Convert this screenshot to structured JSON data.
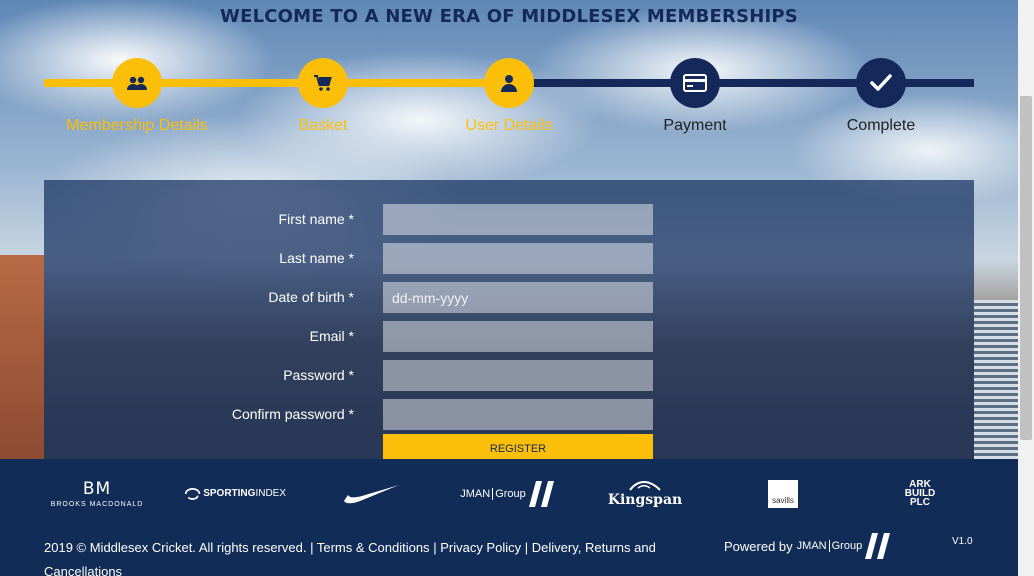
{
  "page": {
    "title": "WELCOME TO A NEW ERA OF MIDDLESEX MEMBERSHIPS"
  },
  "colors": {
    "navy": "#14295a",
    "accent": "#fbbf09",
    "footer": "#112c56"
  },
  "steps": [
    {
      "label": "Membership Details",
      "icon": "users-icon",
      "state": "done"
    },
    {
      "label": "Basket",
      "icon": "cart-icon",
      "state": "done"
    },
    {
      "label": "User Details",
      "icon": "user-icon",
      "state": "done"
    },
    {
      "label": "Payment",
      "icon": "credit-card-icon",
      "state": "todo"
    },
    {
      "label": "Complete",
      "icon": "checkmark-icon",
      "state": "todo"
    }
  ],
  "form": {
    "first_name": {
      "label": "First name *",
      "value": "",
      "placeholder": ""
    },
    "last_name": {
      "label": "Last name *",
      "value": "",
      "placeholder": ""
    },
    "dob": {
      "label": "Date of birth *",
      "value": "",
      "placeholder": "dd-mm-yyyy"
    },
    "email": {
      "label": "Email *",
      "value": "",
      "placeholder": ""
    },
    "password": {
      "label": "Password *",
      "value": "",
      "placeholder": ""
    },
    "confirm_password": {
      "label": "Confirm password *",
      "value": "",
      "placeholder": ""
    },
    "register_label": "REGISTER"
  },
  "sponsors": {
    "brooks_macdonald": {
      "mark": "BM",
      "name": "BROOKS MACDONALD"
    },
    "sporting_index": {
      "a": "SPORTING",
      "b": "INDEX"
    },
    "nike": {
      "icon": "nike-swoosh-icon"
    },
    "jman": {
      "a": "JMAN",
      "b": "Group"
    },
    "kingspan": {
      "name": "Kingspan"
    },
    "savills": {
      "name": "savills"
    },
    "ark": {
      "l1": "ARK",
      "l2": "BUILD",
      "l3": "PLC"
    }
  },
  "footer": {
    "copyright": "2019 © Middlesex Cricket. All rights reserved. |",
    "terms": "Terms & Conditions",
    "sep1": "|",
    "privacy": "Privacy Policy",
    "sep2": "|",
    "delivery": "Delivery, Returns and Cancellations",
    "powered_by": "Powered by",
    "powered_a": "JMAN",
    "powered_b": "Group",
    "version": "V1.0"
  }
}
